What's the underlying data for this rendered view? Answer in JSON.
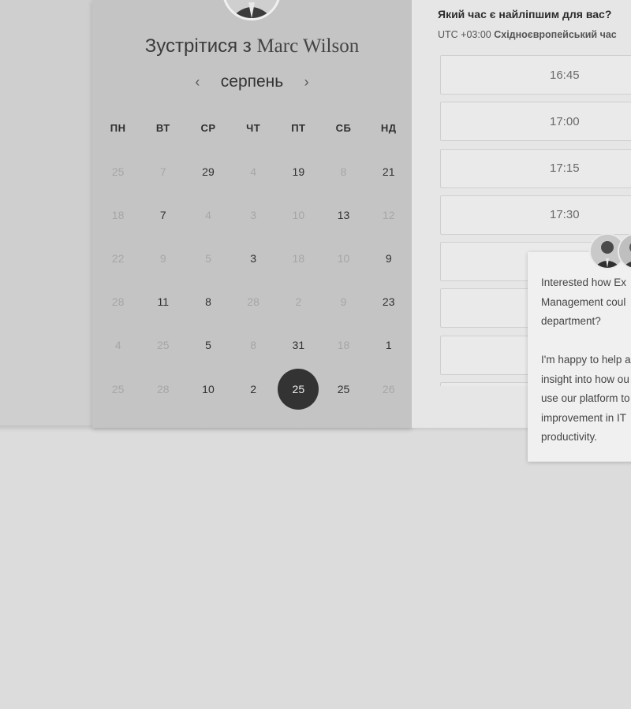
{
  "header": {
    "meet_prefix": "Зустрітися з",
    "host_name": "Marc Wilson"
  },
  "calendar": {
    "month": "серпень",
    "prev_icon": "chevron-left-icon",
    "next_icon": "chevron-right-icon",
    "weekdays": [
      "ПН",
      "ВТ",
      "СР",
      "ЧТ",
      "ПТ",
      "СБ",
      "НД"
    ],
    "rows": [
      [
        {
          "d": "25",
          "a": false
        },
        {
          "d": "7",
          "a": false
        },
        {
          "d": "29",
          "a": true
        },
        {
          "d": "4",
          "a": false
        },
        {
          "d": "19",
          "a": true
        },
        {
          "d": "8",
          "a": false
        },
        {
          "d": "21",
          "a": true
        }
      ],
      [
        {
          "d": "18",
          "a": false
        },
        {
          "d": "7",
          "a": true
        },
        {
          "d": "4",
          "a": false
        },
        {
          "d": "3",
          "a": false
        },
        {
          "d": "10",
          "a": false
        },
        {
          "d": "13",
          "a": true
        },
        {
          "d": "12",
          "a": false
        }
      ],
      [
        {
          "d": "22",
          "a": false
        },
        {
          "d": "9",
          "a": false
        },
        {
          "d": "5",
          "a": false
        },
        {
          "d": "3",
          "a": true
        },
        {
          "d": "18",
          "a": false
        },
        {
          "d": "10",
          "a": false
        },
        {
          "d": "9",
          "a": true
        }
      ],
      [
        {
          "d": "28",
          "a": false
        },
        {
          "d": "11",
          "a": true
        },
        {
          "d": "8",
          "a": true
        },
        {
          "d": "28",
          "a": false
        },
        {
          "d": "2",
          "a": false
        },
        {
          "d": "9",
          "a": false
        },
        {
          "d": "23",
          "a": true
        }
      ],
      [
        {
          "d": "4",
          "a": false
        },
        {
          "d": "25",
          "a": false
        },
        {
          "d": "5",
          "a": true
        },
        {
          "d": "8",
          "a": false
        },
        {
          "d": "31",
          "a": true
        },
        {
          "d": "18",
          "a": false
        },
        {
          "d": "1",
          "a": true
        }
      ],
      [
        {
          "d": "25",
          "a": false
        },
        {
          "d": "28",
          "a": false
        },
        {
          "d": "10",
          "a": true
        },
        {
          "d": "2",
          "a": true
        },
        {
          "d": "25",
          "a": true,
          "selected": true
        },
        {
          "d": "25",
          "a": true
        },
        {
          "d": "26",
          "a": false
        }
      ]
    ]
  },
  "times": {
    "question": "Який час є найліпшим для вас?",
    "tz_offset": "UTC +03:00",
    "tz_name": "Східноєвропейський час",
    "slots": [
      "16:45",
      "17:00",
      "17:15",
      "17:30",
      "",
      "",
      "",
      ""
    ]
  },
  "chat": {
    "message": "Interested how Ex\nManagement coul\ndepartment?\n\nI'm happy to help a\ninsight into how ou\nuse our platform to\nimprovement in IT\nproductivity."
  }
}
